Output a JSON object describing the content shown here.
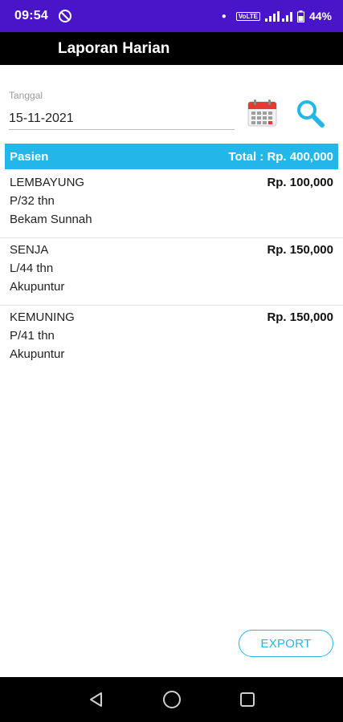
{
  "status_bar": {
    "time": "09:54",
    "volte": "VoLTE",
    "battery": "44%",
    "icons": [
      "sync-icon",
      "dot-icon",
      "wifi-icon",
      "signal-icon",
      "battery-icon"
    ]
  },
  "app_bar": {
    "title": "Laporan Harian"
  },
  "date_field": {
    "label": "Tanggal",
    "value": "15-11-2021"
  },
  "toolbar": {
    "calendar_icon": "calendar-icon",
    "search_icon": "search-icon"
  },
  "table": {
    "header_left": "Pasien",
    "header_right": "Total : Rp. 400,000",
    "rows": [
      {
        "name": "LEMBAYUNG",
        "info": "P/32 thn",
        "treatment": "Bekam Sunnah",
        "amount": "Rp. 100,000"
      },
      {
        "name": "SENJA",
        "info": "L/44 thn",
        "treatment": "Akupuntur",
        "amount": "Rp. 150,000"
      },
      {
        "name": "KEMUNING",
        "info": "P/41 thn",
        "treatment": "Akupuntur",
        "amount": "Rp. 150,000"
      }
    ]
  },
  "export_button": {
    "label": "EXPORT"
  },
  "nav_bar": {
    "icons": [
      "back-icon",
      "home-icon",
      "recents-icon"
    ]
  },
  "colors": {
    "status_bar": "#4a14c8",
    "app_bar": "#000000",
    "accent": "#23b6e9",
    "calendar_red": "#e53935"
  }
}
